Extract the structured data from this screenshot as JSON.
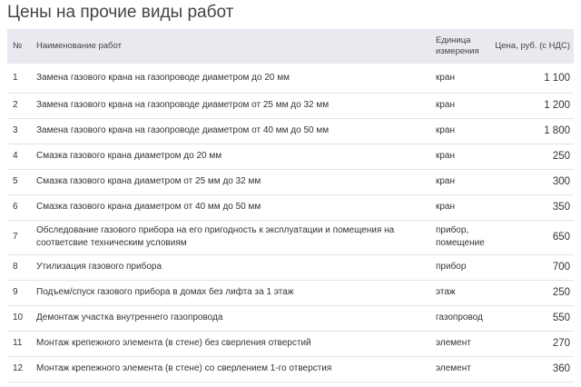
{
  "title": "Цены на прочие виды работ",
  "table": {
    "headers": {
      "num": "№",
      "name": "Наименование работ",
      "unit_line1": "Единица",
      "unit_line2": "измерения",
      "price": "Цена, руб. (с НДС)"
    },
    "rows": [
      {
        "num": "1",
        "name": "Замена газового крана на газопроводе диаметром до 20 мм",
        "unit": "кран",
        "price": "1 100"
      },
      {
        "num": "2",
        "name": "Замена газового крана на газопроводе диаметром от 25 мм до 32 мм",
        "unit": "кран",
        "price": "1 200"
      },
      {
        "num": "3",
        "name": "Замена газового крана на газопроводе диаметром от 40 мм до 50 мм",
        "unit": "кран",
        "price": "1 800"
      },
      {
        "num": "4",
        "name": "Смазка газового крана диаметром до 20 мм",
        "unit": "кран",
        "price": "250"
      },
      {
        "num": "5",
        "name": "Смазка газового крана диаметром от 25 мм до 32 мм",
        "unit": "кран",
        "price": "300"
      },
      {
        "num": "6",
        "name": "Смазка газового крана диаметром от 40 мм до 50 мм",
        "unit": "кран",
        "price": "350"
      },
      {
        "num": "7",
        "name": "Обследование газового прибора на его пригодность к эксплуатации и помещения на соответсвие техническим условиям",
        "unit": "прибор, помещение",
        "price": "650"
      },
      {
        "num": "8",
        "name": "Утилизация газового прибора",
        "unit": "прибор",
        "price": "700"
      },
      {
        "num": "9",
        "name": "Подъем/спуск газового прибора в домах без лифта за 1 этаж",
        "unit": "этаж",
        "price": "250"
      },
      {
        "num": "10",
        "name": "Демонтаж участка внутреннего газопровода",
        "unit": "газопровод",
        "price": "550"
      },
      {
        "num": "11",
        "name": "Монтаж крепежного элемента (в стене) без сверления отверстий",
        "unit": "элемент",
        "price": "270"
      },
      {
        "num": "12",
        "name": "Монтаж крепежного элемента (в стене) со сверлением 1-го отверстия",
        "unit": "элемент",
        "price": "360"
      }
    ]
  }
}
